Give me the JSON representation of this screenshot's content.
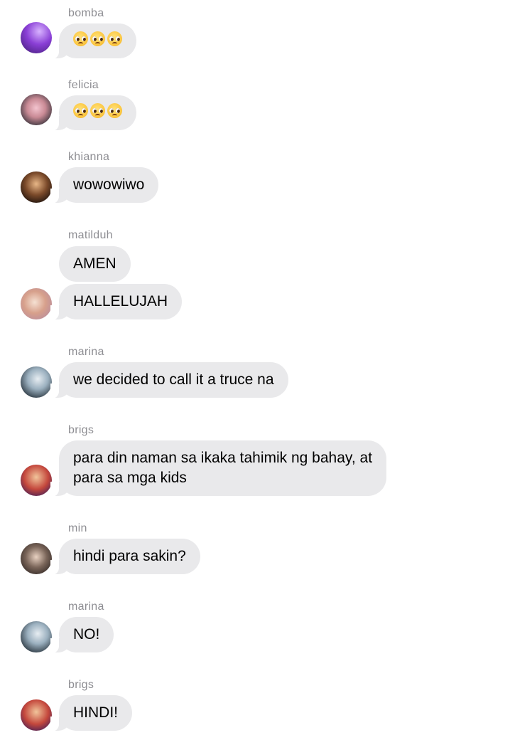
{
  "messages": [
    {
      "sender": "bomba",
      "emoji": [
        "pleading-face-emoji",
        "pleading-face-emoji",
        "pleading-face-emoji"
      ]
    },
    {
      "sender": "felicia",
      "emoji": [
        "pleading-face-emoji",
        "pleading-face-emoji",
        "pleading-face-emoji"
      ]
    },
    {
      "sender": "khianna",
      "text": "wowowiwo"
    },
    {
      "sender": "matilduh",
      "texts": [
        "AMEN",
        "HALLELUJAH"
      ]
    },
    {
      "sender": "marina",
      "text": "we decided to call it a truce na"
    },
    {
      "sender": "brigs",
      "lines": [
        "para din naman sa ikaka tahimik ng bahay, at",
        "para sa mga kids"
      ]
    },
    {
      "sender": "min",
      "text": "hindi para sakin?"
    },
    {
      "sender": "marina",
      "text": "NO!"
    },
    {
      "sender": "brigs",
      "text": "HINDI!"
    }
  ],
  "colors": {
    "bubble": "#e9e9eb",
    "sender_name": "#8e8e93",
    "background": "#ffffff"
  }
}
